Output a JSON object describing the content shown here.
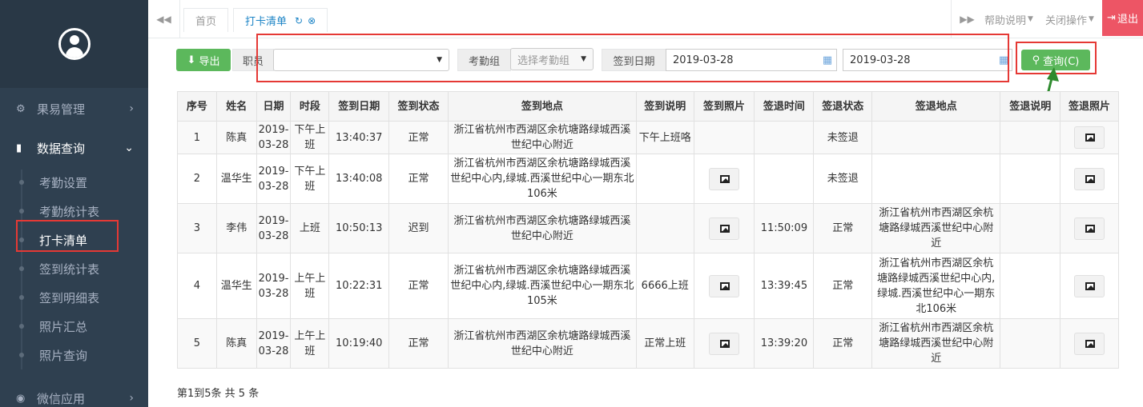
{
  "sidebar": {
    "menu": [
      {
        "label": "果易管理",
        "icon": "gear-icon"
      },
      {
        "label": "数据查询",
        "icon": "bar-chart-icon"
      },
      {
        "label": "微信应用",
        "icon": "wechat-icon"
      }
    ],
    "submenu": [
      "考勤设置",
      "考勤统计表",
      "打卡清单",
      "签到统计表",
      "签到明细表",
      "照片汇总",
      "照片查询"
    ]
  },
  "topbar": {
    "tabs": [
      "首页",
      "打卡清单"
    ],
    "help": "帮助说明",
    "close_ops": "关闭操作",
    "logout": "退出"
  },
  "toolbar": {
    "export_label": "导出",
    "staff_label": "职员",
    "staff_value": "",
    "group_label": "考勤组",
    "group_placeholder": "选择考勤组",
    "date_label": "签到日期",
    "date_from": "2019-03-28",
    "date_to": "2019-03-28",
    "query_label": "查询(C)"
  },
  "table": {
    "headers": [
      "序号",
      "姓名",
      "日期",
      "时段",
      "签到日期",
      "签到状态",
      "签到地点",
      "签到说明",
      "签到照片",
      "签退时间",
      "签退状态",
      "签退地点",
      "签退说明",
      "签退照片"
    ],
    "rows": [
      {
        "no": "1",
        "name": "陈真",
        "date": "2019-03-28",
        "period": "下午上班",
        "in_time": "13:40:37",
        "in_status": "正常",
        "in_place": "浙江省杭州市西湖区余杭塘路绿城西溪世纪中心附近",
        "in_note": "下午上班咯",
        "in_photo": false,
        "out_time": "",
        "out_status": "未签退",
        "out_place": "",
        "out_note": "",
        "out_photo": true
      },
      {
        "no": "2",
        "name": "温华生",
        "date": "2019-03-28",
        "period": "下午上班",
        "in_time": "13:40:08",
        "in_status": "正常",
        "in_place": "浙江省杭州市西湖区余杭塘路绿城西溪世纪中心内,绿城.西溪世纪中心一期东北106米",
        "in_note": "",
        "in_photo": true,
        "out_time": "",
        "out_status": "未签退",
        "out_place": "",
        "out_note": "",
        "out_photo": true
      },
      {
        "no": "3",
        "name": "李伟",
        "date": "2019-03-28",
        "period": "上班",
        "in_time": "10:50:13",
        "in_status": "迟到",
        "in_place": "浙江省杭州市西湖区余杭塘路绿城西溪世纪中心附近",
        "in_note": "",
        "in_photo": true,
        "out_time": "11:50:09",
        "out_status": "正常",
        "out_place": "浙江省杭州市西湖区余杭塘路绿城西溪世纪中心附近",
        "out_note": "",
        "out_photo": true
      },
      {
        "no": "4",
        "name": "温华生",
        "date": "2019-03-28",
        "period": "上午上班",
        "in_time": "10:22:31",
        "in_status": "正常",
        "in_place": "浙江省杭州市西湖区余杭塘路绿城西溪世纪中心内,绿城.西溪世纪中心一期东北105米",
        "in_note": "6666上班",
        "in_photo": true,
        "out_time": "13:39:45",
        "out_status": "正常",
        "out_place": "浙江省杭州市西湖区余杭塘路绿城西溪世纪中心内,绿城.西溪世纪中心一期东北106米",
        "out_note": "",
        "out_photo": true
      },
      {
        "no": "5",
        "name": "陈真",
        "date": "2019-03-28",
        "period": "上午上班",
        "in_time": "10:19:40",
        "in_status": "正常",
        "in_place": "浙江省杭州市西湖区余杭塘路绿城西溪世纪中心附近",
        "in_note": "正常上班",
        "in_photo": true,
        "out_time": "13:39:20",
        "out_status": "正常",
        "out_place": "浙江省杭州市西湖区余杭塘路绿城西溪世纪中心附近",
        "out_note": "",
        "out_photo": true
      }
    ]
  },
  "footer": {
    "info": "第1到5条 共 5 条"
  },
  "colors": {
    "sidebar_bg": "#2f4050",
    "accent_green": "#5cb85c",
    "logout_red": "#ed5565",
    "highlight": "#e53935"
  }
}
